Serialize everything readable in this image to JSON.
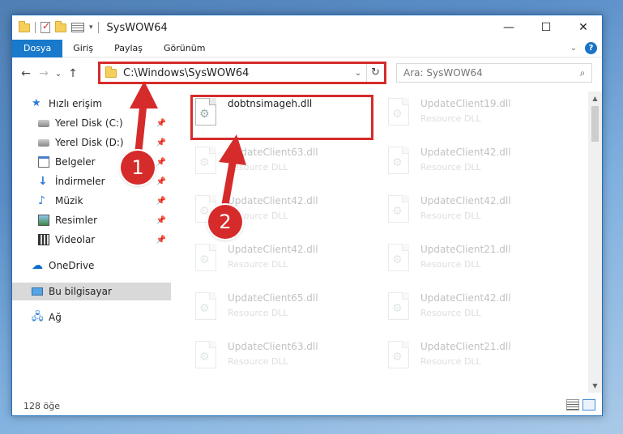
{
  "window": {
    "title": "SysWOW64",
    "minimize_label": "—",
    "maximize_label": "☐",
    "close_label": "✕"
  },
  "ribbon": {
    "tabs": [
      {
        "label": "Dosya",
        "active": true
      },
      {
        "label": "Giriş"
      },
      {
        "label": "Paylaş"
      },
      {
        "label": "Görünüm"
      }
    ],
    "help_label": "?"
  },
  "address": {
    "path": "C:\\Windows\\SysWOW64",
    "refresh_label": "↻"
  },
  "search": {
    "placeholder": "Ara: SysWOW64"
  },
  "nav": {
    "back_label": "←",
    "forward_label": "→",
    "history_label": "⌄",
    "up_label": "↑",
    "items": [
      {
        "label": "Hızlı erişim",
        "icon": "star-icon"
      },
      {
        "label": "Yerel Disk (C:)",
        "icon": "disk-icon",
        "pinned": true
      },
      {
        "label": "Yerel Disk (D:)",
        "icon": "disk-icon",
        "pinned": true
      },
      {
        "label": "Belgeler",
        "icon": "documents-icon",
        "pinned": true
      },
      {
        "label": "İndirmeler",
        "icon": "download-icon",
        "pinned": true
      },
      {
        "label": "Müzik",
        "icon": "music-icon",
        "pinned": true
      },
      {
        "label": "Resimler",
        "icon": "pictures-icon",
        "pinned": true
      },
      {
        "label": "Videolar",
        "icon": "videos-icon",
        "pinned": true
      },
      {
        "label": "OneDrive",
        "icon": "onedrive-icon"
      },
      {
        "label": "Bu bilgisayar",
        "icon": "computer-icon",
        "selected": true
      },
      {
        "label": "Ağ",
        "icon": "network-icon"
      }
    ]
  },
  "files": [
    {
      "name": "dobtnsimageh.dll",
      "type": "",
      "highlighted": true
    },
    {
      "name": "UpdateClient19.dll",
      "type": "Resource DLL"
    },
    {
      "name": "UpdateClient63.dll",
      "type": "Resource DLL"
    },
    {
      "name": "UpdateClient42.dll",
      "type": "Resource DLL"
    },
    {
      "name": "UpdateClient42.dll",
      "type": "Resource DLL"
    },
    {
      "name": "UpdateClient42.dll",
      "type": "Resource DLL"
    },
    {
      "name": "UpdateClient42.dll",
      "type": "Resource DLL"
    },
    {
      "name": "UpdateClient21.dll",
      "type": "Resource DLL"
    },
    {
      "name": "UpdateClient65.dll",
      "type": "Resource DLL"
    },
    {
      "name": "UpdateClient42.dll",
      "type": "Resource DLL"
    },
    {
      "name": "UpdateClient63.dll",
      "type": "Resource DLL"
    },
    {
      "name": "UpdateClient21.dll",
      "type": "Resource DLL"
    }
  ],
  "status": {
    "item_count": "128 öğe"
  },
  "annotations": {
    "step1": "1",
    "step2": "2",
    "color": "#d62b2b"
  }
}
